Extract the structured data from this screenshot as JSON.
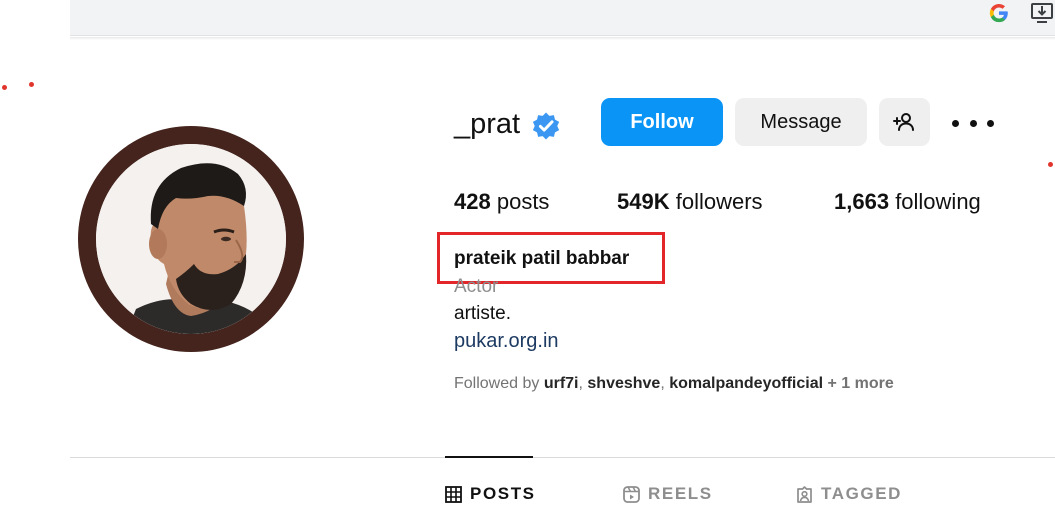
{
  "profile": {
    "username": "_prat",
    "full_name": "prateik patil babbar",
    "category": "Actor",
    "bio": "artiste.",
    "link": "pukar.org.in"
  },
  "actions": {
    "follow_label": "Follow",
    "message_label": "Message",
    "suggest_icon": "add-person-icon",
    "more_icon": "more-options-icon"
  },
  "stats": {
    "posts_count": "428",
    "posts_label": "posts",
    "followers_count": "549K",
    "followers_label": "followers",
    "following_count": "1,663",
    "following_label": "following"
  },
  "followed_by": {
    "prefix": "Followed by",
    "accounts": [
      "urf7i",
      "shveshve",
      "komalpandeyofficial"
    ],
    "more": "+ 1 more"
  },
  "tabs": [
    {
      "label": "POSTS",
      "icon": "grid-icon",
      "active": true
    },
    {
      "label": "REELS",
      "icon": "reels-icon",
      "active": false
    },
    {
      "label": "TAGGED",
      "icon": "tagged-icon",
      "active": false
    }
  ],
  "colors": {
    "follow_blue": "#0a95f6",
    "verified_blue": "#3b97f1",
    "highlight_red": "#e2262a",
    "avatar_ring": "#44241d",
    "link_color": "#1c3a62"
  }
}
